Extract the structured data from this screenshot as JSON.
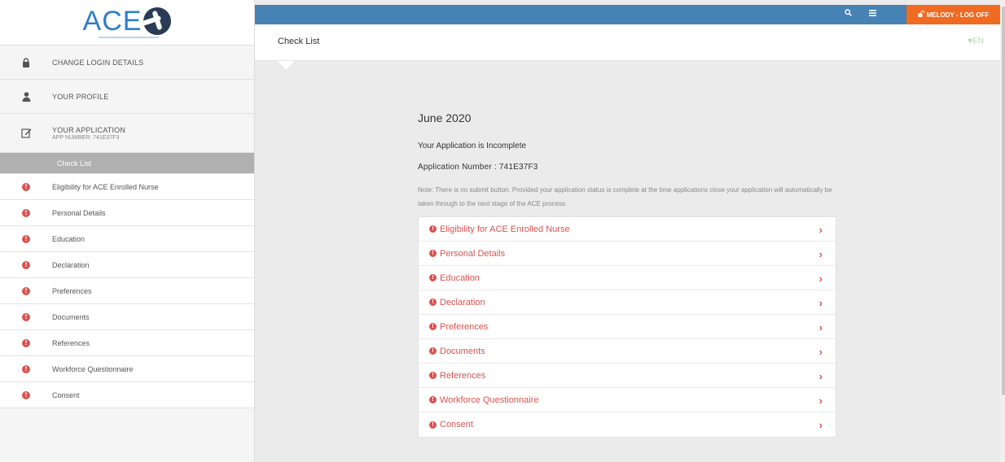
{
  "logo": {
    "text": "ACE"
  },
  "topbar": {
    "logoff_label": "MELODY - LOG OFF",
    "search_icon": "search-icon",
    "menu_icon": "menu-icon"
  },
  "header": {
    "page_title": "Check List",
    "language": "EN"
  },
  "sidebar": {
    "main_items": [
      {
        "label": "CHANGE LOGIN DETAILS",
        "icon": "lock-icon"
      },
      {
        "label": "YOUR PROFILE",
        "icon": "user-icon"
      },
      {
        "label": "YOUR APPLICATION",
        "sub": "APP NUMBER: 741E37F3",
        "icon": "edit-icon"
      }
    ],
    "active_item": "Check List",
    "checklist_items": [
      "Eligibility for ACE Enrolled Nurse",
      "Personal Details",
      "Education",
      "Declaration",
      "Preferences",
      "Documents",
      "References",
      "Workforce Questionnaire",
      "Consent"
    ]
  },
  "content": {
    "title": "June 2020",
    "status": "Your Application is Incomplete",
    "app_number": "Application Number : 741E37F3",
    "note": "Note: There is no submit button. Provided your application status is complete at the time applications close your application will automatically be taken through to the next stage of the ACE process.",
    "checklist": [
      "Eligibility for ACE Enrolled Nurse",
      "Personal Details",
      "Education",
      "Declaration",
      "Preferences",
      "Documents",
      "References",
      "Workforce Questionnaire",
      "Consent"
    ]
  },
  "colors": {
    "topbar": "#4682b4",
    "logoff": "#ef6b22",
    "error": "#d9534f",
    "active": "#b0b0b0"
  }
}
